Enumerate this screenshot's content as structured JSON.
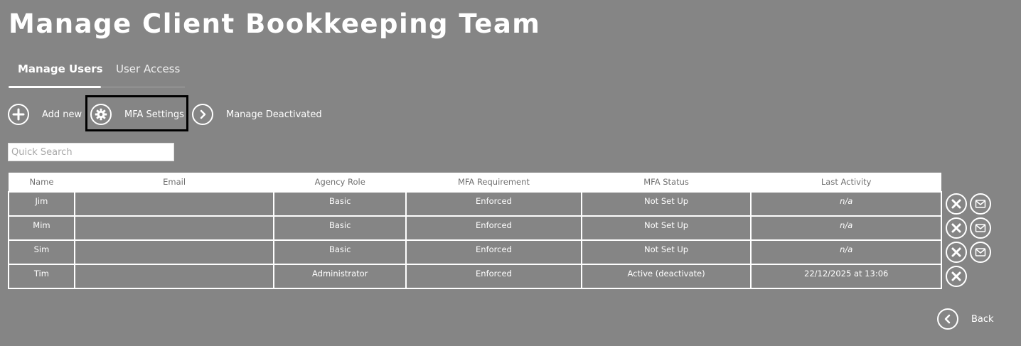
{
  "page": {
    "title": "Manage Client Bookkeeping Team"
  },
  "tabs": [
    {
      "label": "Manage Users",
      "active": true
    },
    {
      "label": "User Access",
      "active": false
    }
  ],
  "toolbar": {
    "add_new": {
      "label": "Add new",
      "icon": "plus-circle-icon"
    },
    "mfa_settings": {
      "label": "MFA Settings",
      "icon": "gear-icon"
    },
    "manage_deactivated": {
      "label": "Manage Deactivated",
      "icon": "chevron-right-icon"
    }
  },
  "search": {
    "placeholder": "Quick Search",
    "value": ""
  },
  "table": {
    "columns": [
      "Name",
      "Email",
      "Agency Role",
      "MFA Requirement",
      "MFA Status",
      "Last Activity"
    ],
    "rows": [
      {
        "name": "Jim",
        "email": "",
        "role": "Basic",
        "mfa_requirement": "Enforced",
        "mfa_status": "Not Set Up",
        "last_activity": "n/a",
        "actions": [
          "remove-icon",
          "email-icon"
        ]
      },
      {
        "name": "Mim",
        "email": "",
        "role": "Basic",
        "mfa_requirement": "Enforced",
        "mfa_status": "Not Set Up",
        "last_activity": "n/a",
        "actions": [
          "remove-icon",
          "email-icon"
        ]
      },
      {
        "name": "Sim",
        "email": "",
        "role": "Basic",
        "mfa_requirement": "Enforced",
        "mfa_status": "Not Set Up",
        "last_activity": "n/a",
        "actions": [
          "remove-icon",
          "email-icon"
        ]
      },
      {
        "name": "Tim",
        "email": "",
        "role": "Administrator",
        "mfa_requirement": "Enforced",
        "mfa_status": "Active (deactivate)",
        "last_activity": "22/12/2025 at 13:06",
        "actions": [
          "remove-icon"
        ]
      }
    ]
  },
  "footer": {
    "back_label": "Back",
    "back_icon": "chevron-left-icon"
  },
  "colors": {
    "background": "#858585",
    "foreground": "#ffffff",
    "highlight_border": "#000000",
    "header_text": "#707070"
  }
}
